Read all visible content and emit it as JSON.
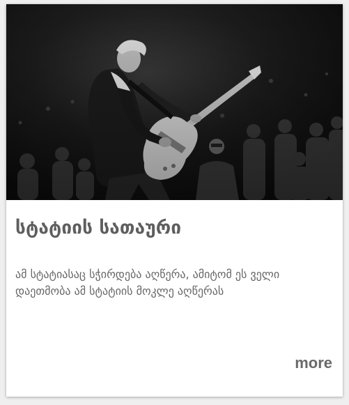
{
  "card": {
    "image_alt": "",
    "title": "სტატიის სათაური",
    "description": "ამ სტატიასაც სჭირდება აღწერა, ამიტომ ეს ველი დაეთმობა ამ სტატიის მოკლე აღწერას",
    "more_label": "more"
  },
  "colors": {
    "page_background": "#efefef",
    "card_background": "#ffffff",
    "title_text": "#5e5e5e",
    "body_text": "#666666",
    "link_text": "#6a6a6a"
  }
}
